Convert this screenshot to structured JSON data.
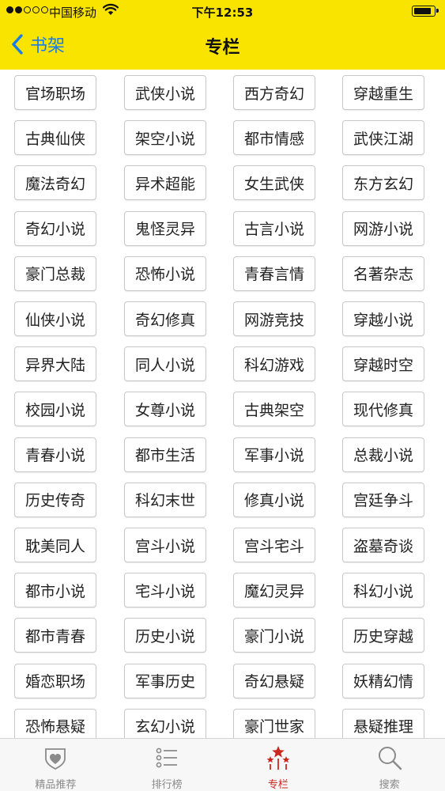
{
  "status_bar": {
    "carrier": "中国移动",
    "time": "下午12:53",
    "signal_bars_filled": 2,
    "signal_bars_total": 5,
    "battery_level": 0.95
  },
  "nav": {
    "back_label": "书架",
    "title": "专栏",
    "accent_color": "#f9e400",
    "link_color": "#1a7ce8"
  },
  "categories": [
    "官场职场",
    "武侠小说",
    "西方奇幻",
    "穿越重生",
    "古典仙侠",
    "架空小说",
    "都市情感",
    "武侠江湖",
    "魔法奇幻",
    "异术超能",
    "女生武侠",
    "东方玄幻",
    "奇幻小说",
    "鬼怪灵异",
    "古言小说",
    "网游小说",
    "豪门总裁",
    "恐怖小说",
    "青春言情",
    "名著杂志",
    "仙侠小说",
    "奇幻修真",
    "网游竞技",
    "穿越小说",
    "异界大陆",
    "同人小说",
    "科幻游戏",
    "穿越时空",
    "校园小说",
    "女尊小说",
    "古典架空",
    "现代修真",
    "青春小说",
    "都市生活",
    "军事小说",
    "总裁小说",
    "历史传奇",
    "科幻末世",
    "修真小说",
    "宫廷争斗",
    "耽美同人",
    "宫斗小说",
    "宫斗宅斗",
    "盗墓奇谈",
    "都市小说",
    "宅斗小说",
    "魔幻灵异",
    "科幻小说",
    "都市青春",
    "历史小说",
    "豪门小说",
    "历史穿越",
    "婚恋职场",
    "军事历史",
    "奇幻悬疑",
    "妖精幻情",
    "恐怖悬疑",
    "玄幻小说",
    "豪门世家",
    "悬疑推理"
  ],
  "tabbar": {
    "items": [
      {
        "label": "精品推荐",
        "icon": "heart-shield-icon"
      },
      {
        "label": "排行榜",
        "icon": "list-icon"
      },
      {
        "label": "专栏",
        "icon": "stars-icon"
      },
      {
        "label": "搜索",
        "icon": "search-icon"
      }
    ],
    "active_index": 2,
    "active_color": "#c9281f",
    "inactive_color": "#8a8a8a"
  }
}
